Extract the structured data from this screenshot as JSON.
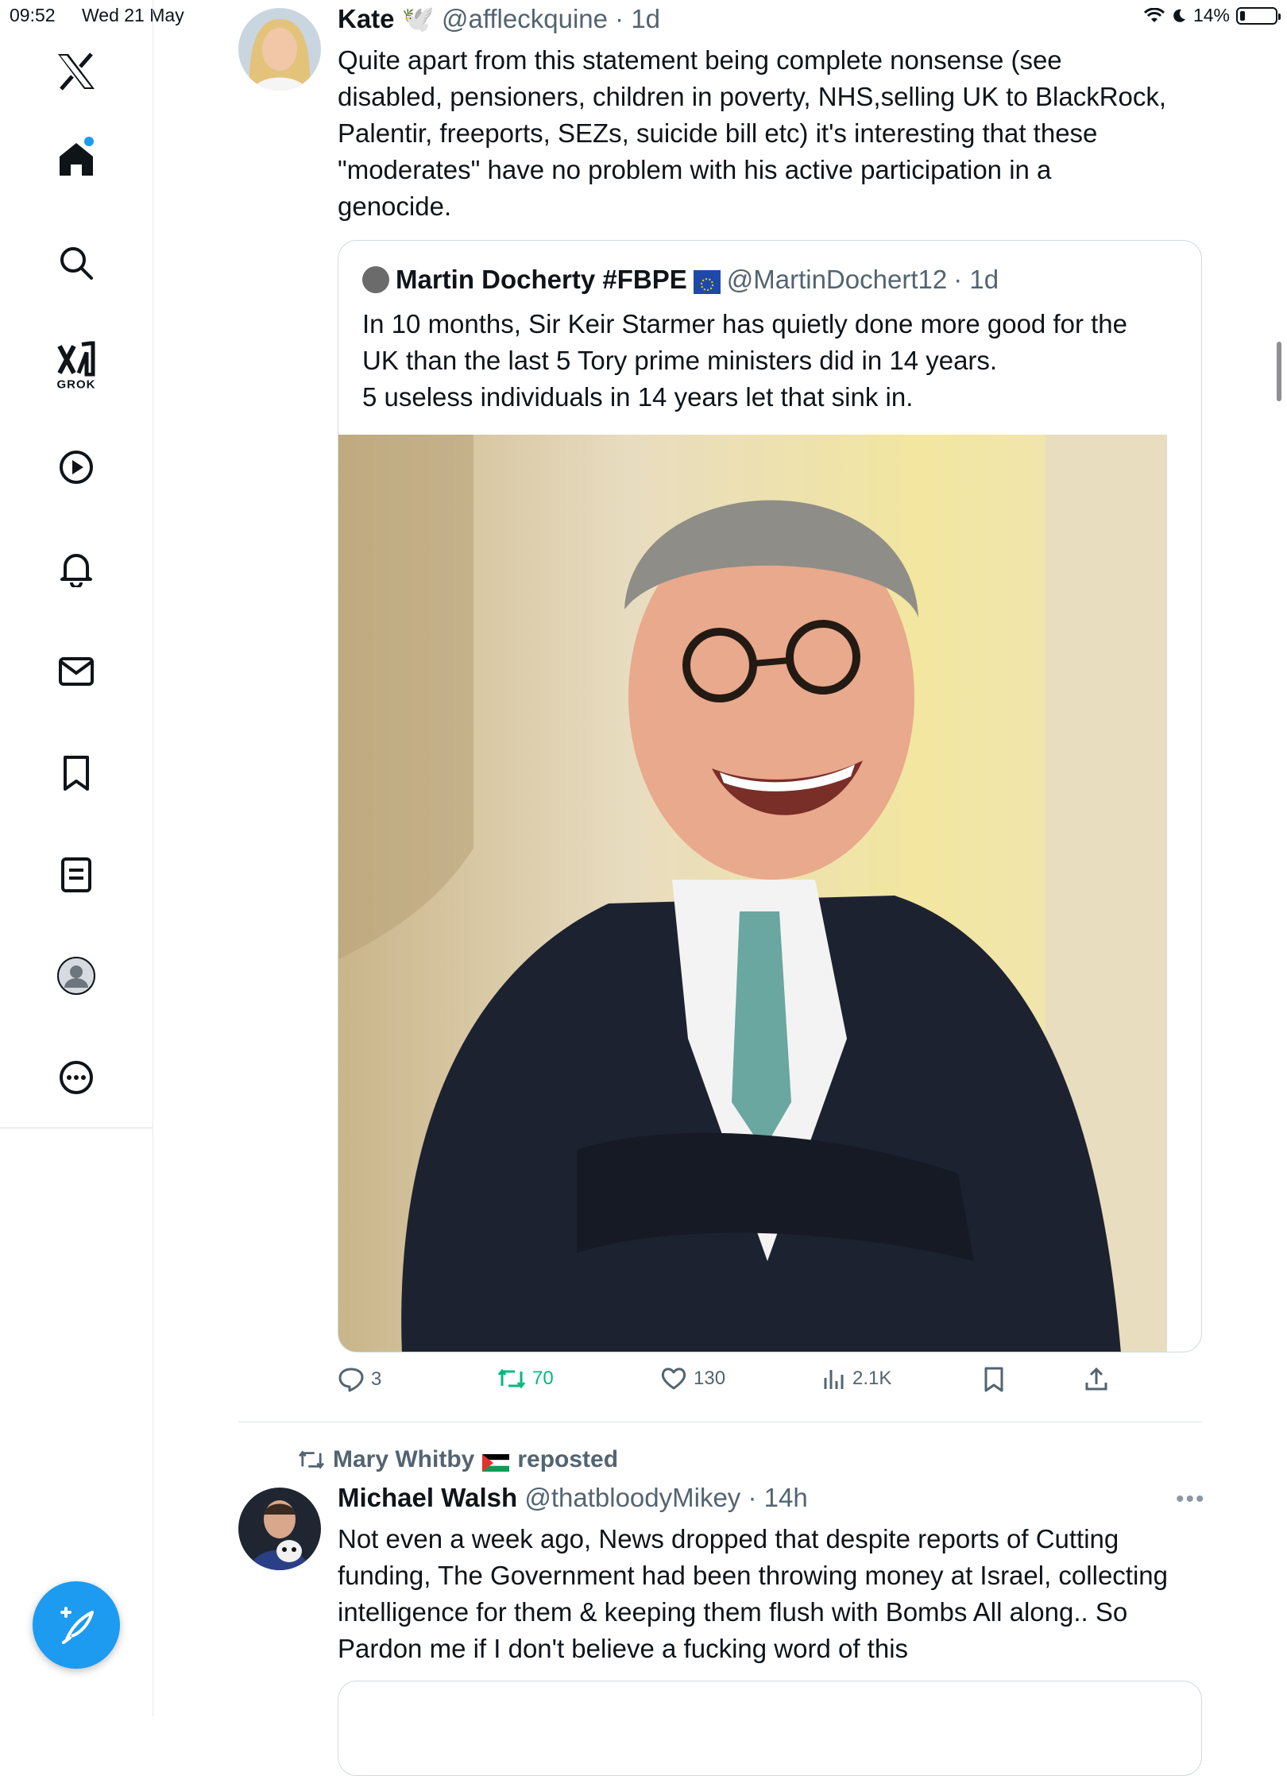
{
  "status_bar": {
    "time": "09:52",
    "date": "Wed 21 May",
    "battery": "14%",
    "battery_level": 0.14
  },
  "sidebar": {
    "items": [
      {
        "icon": "x-logo"
      },
      {
        "icon": "home-icon",
        "has_notification_dot": true
      },
      {
        "icon": "search-icon"
      },
      {
        "icon": "grok-icon",
        "label": "GROK"
      },
      {
        "icon": "video-icon"
      },
      {
        "icon": "notifications-icon"
      },
      {
        "icon": "messages-icon"
      },
      {
        "icon": "bookmarks-icon"
      },
      {
        "icon": "lists-icon"
      },
      {
        "icon": "profile-icon"
      },
      {
        "icon": "more-icon"
      }
    ],
    "compose_icon": "compose-icon"
  },
  "tweet1": {
    "name": "Kate",
    "name_emoji": "🕊️",
    "handle": "@affleckquine",
    "time": "· 1d",
    "text_lines": [
      "Quite apart from this statement being complete nonsense (see",
      "disabled, pensioners, children in poverty, NHS,selling UK to BlackRock,",
      "Palentir, freeports, SEZs, suicide bill etc) it's interesting that these",
      "\"moderates\" have no problem with his active participation in a",
      "genocide."
    ],
    "quote": {
      "name": "Martin Docherty #FBPE",
      "handle": "@MartinDochert12",
      "time": "· 1d",
      "text_lines": [
        "In 10 months, Sir Keir Starmer has quietly done more good for the",
        "UK than the last 5 Tory prime ministers did in 14 years.",
        "5 useless individuals in 14 years let that sink in."
      ]
    },
    "actions": {
      "replies": "3",
      "reposts": "70",
      "likes": "130",
      "views": "2.1K"
    },
    "colors": {
      "repost_green": "#00ba7c",
      "muted": "#536471"
    }
  },
  "repost_banner": {
    "text_before": "Mary Whitby",
    "text_after": "reposted"
  },
  "tweet2": {
    "name": "Michael Walsh",
    "handle": "@thatbloodyMikey",
    "time": "· 14h",
    "text_lines": [
      "Not even a week ago, News dropped that despite reports of Cutting",
      "funding, The Government had been throwing money at Israel, collecting",
      "intelligence for them & keeping them flush with Bombs All along.. So",
      "Pardon me if I don't believe a fucking word of this"
    ]
  },
  "accent_color": "#1d9bf0"
}
